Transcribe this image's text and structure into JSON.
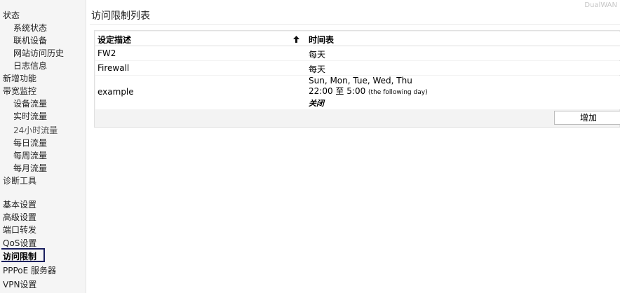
{
  "brand": "DualWAN",
  "sidebar": {
    "items": [
      {
        "label": "状态"
      },
      {
        "label": "系统状态"
      },
      {
        "label": "联机设备"
      },
      {
        "label": "网站访问历史"
      },
      {
        "label": "日志信息"
      },
      {
        "label": "新增功能"
      },
      {
        "label": "带宽监控"
      },
      {
        "label": "设备流量"
      },
      {
        "label": "实时流量"
      },
      {
        "label": "24小时流量"
      },
      {
        "label": "每日流量"
      },
      {
        "label": "每周流量"
      },
      {
        "label": "每月流量"
      },
      {
        "label": "诊断工具"
      },
      {
        "label": "基本设置"
      },
      {
        "label": "高级设置"
      },
      {
        "label": "端口转发"
      },
      {
        "label": "QoS设置"
      },
      {
        "label": "访问限制"
      },
      {
        "label": "PPPoE 服务器"
      },
      {
        "label": "VPN设置"
      }
    ]
  },
  "page": {
    "title": "访问限制列表"
  },
  "table": {
    "headers": {
      "description": "设定描述",
      "schedule": "时间表"
    },
    "sort_icon": "sort-ascending-arrow-icon",
    "rows": [
      {
        "name": "FW2",
        "schedule": "每天"
      },
      {
        "name": "Firewall",
        "schedule": "每天"
      },
      {
        "name": "example",
        "days": "Sun, Mon, Tue, Wed, Thu",
        "start": "22:00",
        "to": "至",
        "end": "5:00",
        "note": "(the following day)",
        "status": "关闭"
      }
    ],
    "add_button": "增加"
  }
}
